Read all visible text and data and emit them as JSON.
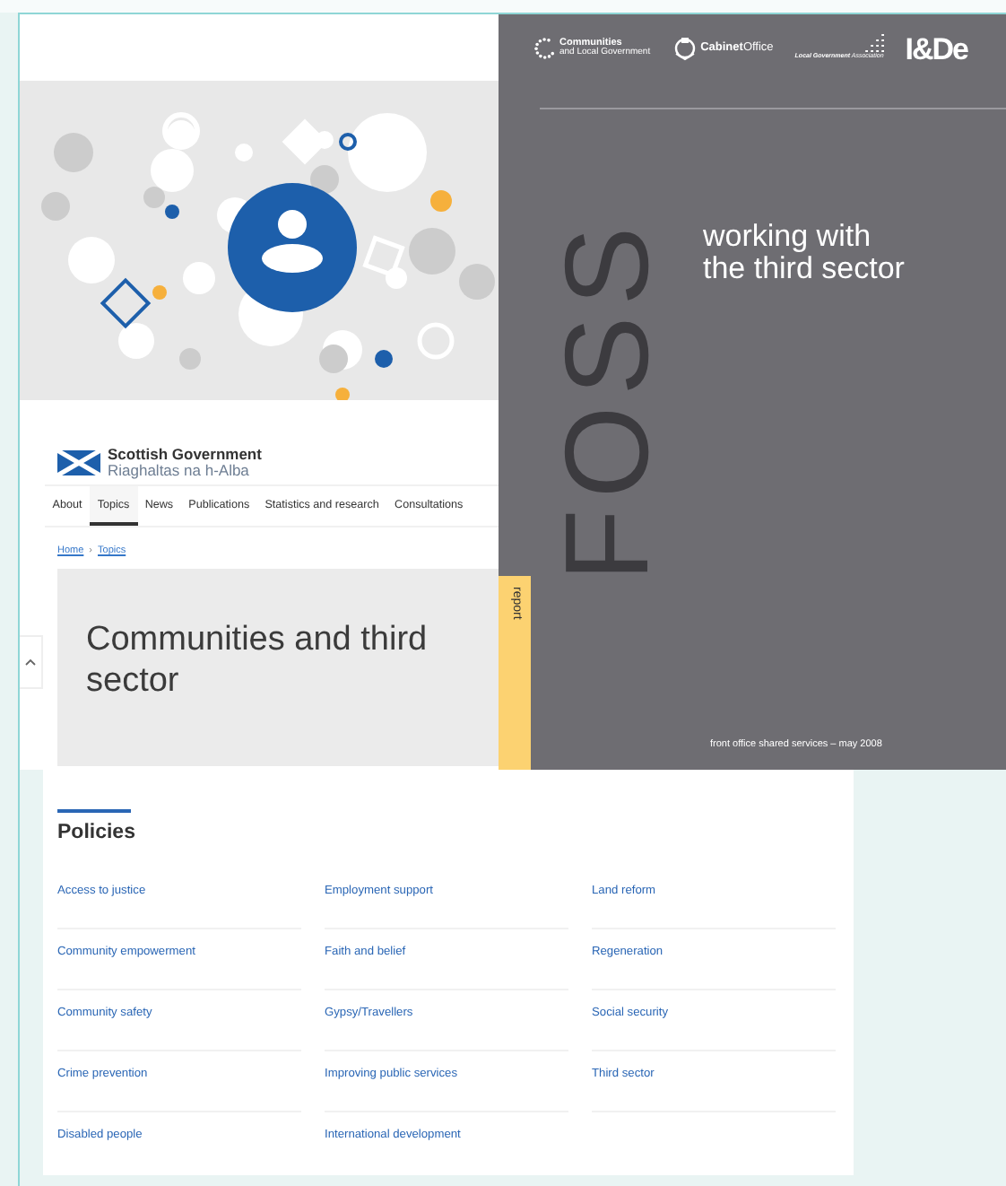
{
  "site": {
    "name": "Scottish Government",
    "name_gaelic": "Riaghaltas na h-Alba"
  },
  "nav": [
    {
      "label": "About",
      "selected": false
    },
    {
      "label": "Topics",
      "selected": true
    },
    {
      "label": "News",
      "selected": false
    },
    {
      "label": "Publications",
      "selected": false
    },
    {
      "label": "Statistics and research",
      "selected": false
    },
    {
      "label": "Consultations",
      "selected": false
    }
  ],
  "breadcrumb": {
    "items": [
      "Home",
      "Topics"
    ],
    "separator": "›"
  },
  "page_title": "Communities and third sector",
  "policies": {
    "heading": "Policies",
    "links": [
      "Access to justice",
      "Employment support",
      "Land reform",
      "Community empowerment",
      "Faith and belief",
      "Regeneration",
      "Community safety",
      "Gypsy/Travellers",
      "Social security",
      "Crime prevention",
      "Improving public services",
      "Third sector",
      "Disabled people",
      "International development"
    ]
  },
  "cover": {
    "logos": [
      {
        "kind": "communities",
        "text": "Communities",
        "subtext": "and Local Government"
      },
      {
        "kind": "cabinet",
        "text": "**Cabinet**Office"
      },
      {
        "kind": "lga",
        "text": "**Local Government** Association"
      },
      {
        "kind": "idea",
        "text": "I&De"
      }
    ],
    "vertical_title": "FOSS",
    "subtitle": [
      "working with",
      "the third sector"
    ],
    "tag": "report",
    "footer": "front office shared services – may 2008"
  }
}
